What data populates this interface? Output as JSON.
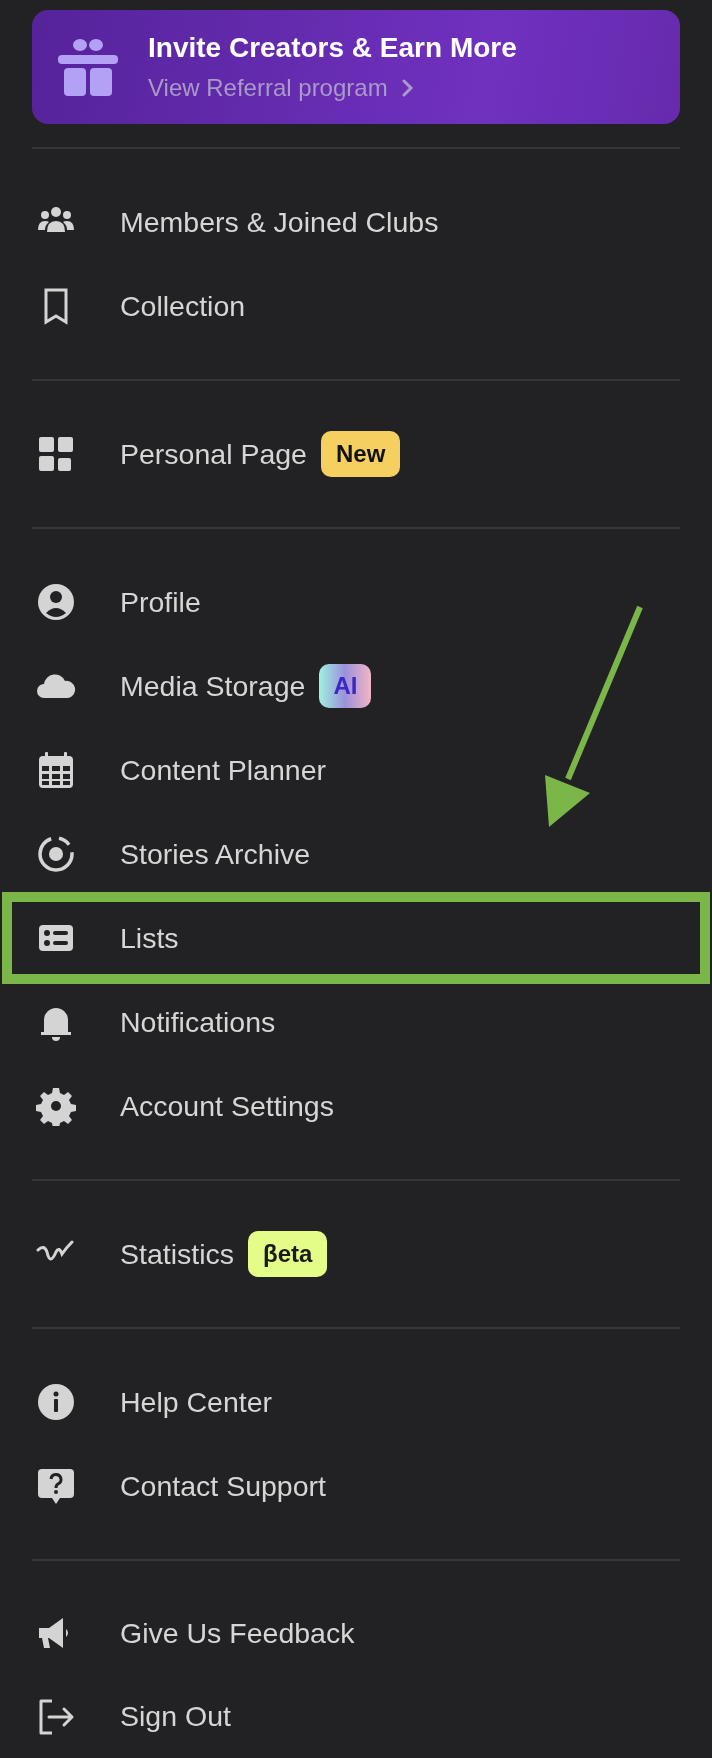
{
  "banner": {
    "title": "Invite Creators & Earn More",
    "link": "View Referral program"
  },
  "sections": [
    {
      "items": [
        {
          "label": "Members & Joined Clubs",
          "highlighted": false
        },
        {
          "label": "Collection",
          "highlighted": false
        }
      ]
    },
    {
      "items": [
        {
          "label": "Personal Page",
          "highlighted": false,
          "badge": {
            "text": "New",
            "kind": "new"
          }
        }
      ]
    },
    {
      "items": [
        {
          "label": "Profile",
          "highlighted": false
        },
        {
          "label": "Media Storage",
          "highlighted": false,
          "badge": {
            "text": "AI",
            "kind": "ai"
          }
        },
        {
          "label": "Content Planner",
          "highlighted": false
        },
        {
          "label": "Stories Archive",
          "highlighted": false
        },
        {
          "label": "Lists",
          "highlighted": true
        },
        {
          "label": "Notifications",
          "highlighted": false
        },
        {
          "label": "Account Settings",
          "highlighted": false
        }
      ]
    },
    {
      "items": [
        {
          "label": "Statistics",
          "highlighted": false,
          "badge": {
            "text": "βeta",
            "kind": "beta"
          }
        }
      ]
    },
    {
      "items": [
        {
          "label": "Help Center",
          "highlighted": false
        },
        {
          "label": "Contact Support",
          "highlighted": false
        }
      ]
    },
    {
      "items": [
        {
          "label": "Give Us Feedback",
          "highlighted": false
        },
        {
          "label": "Sign Out",
          "highlighted": false
        }
      ]
    }
  ]
}
